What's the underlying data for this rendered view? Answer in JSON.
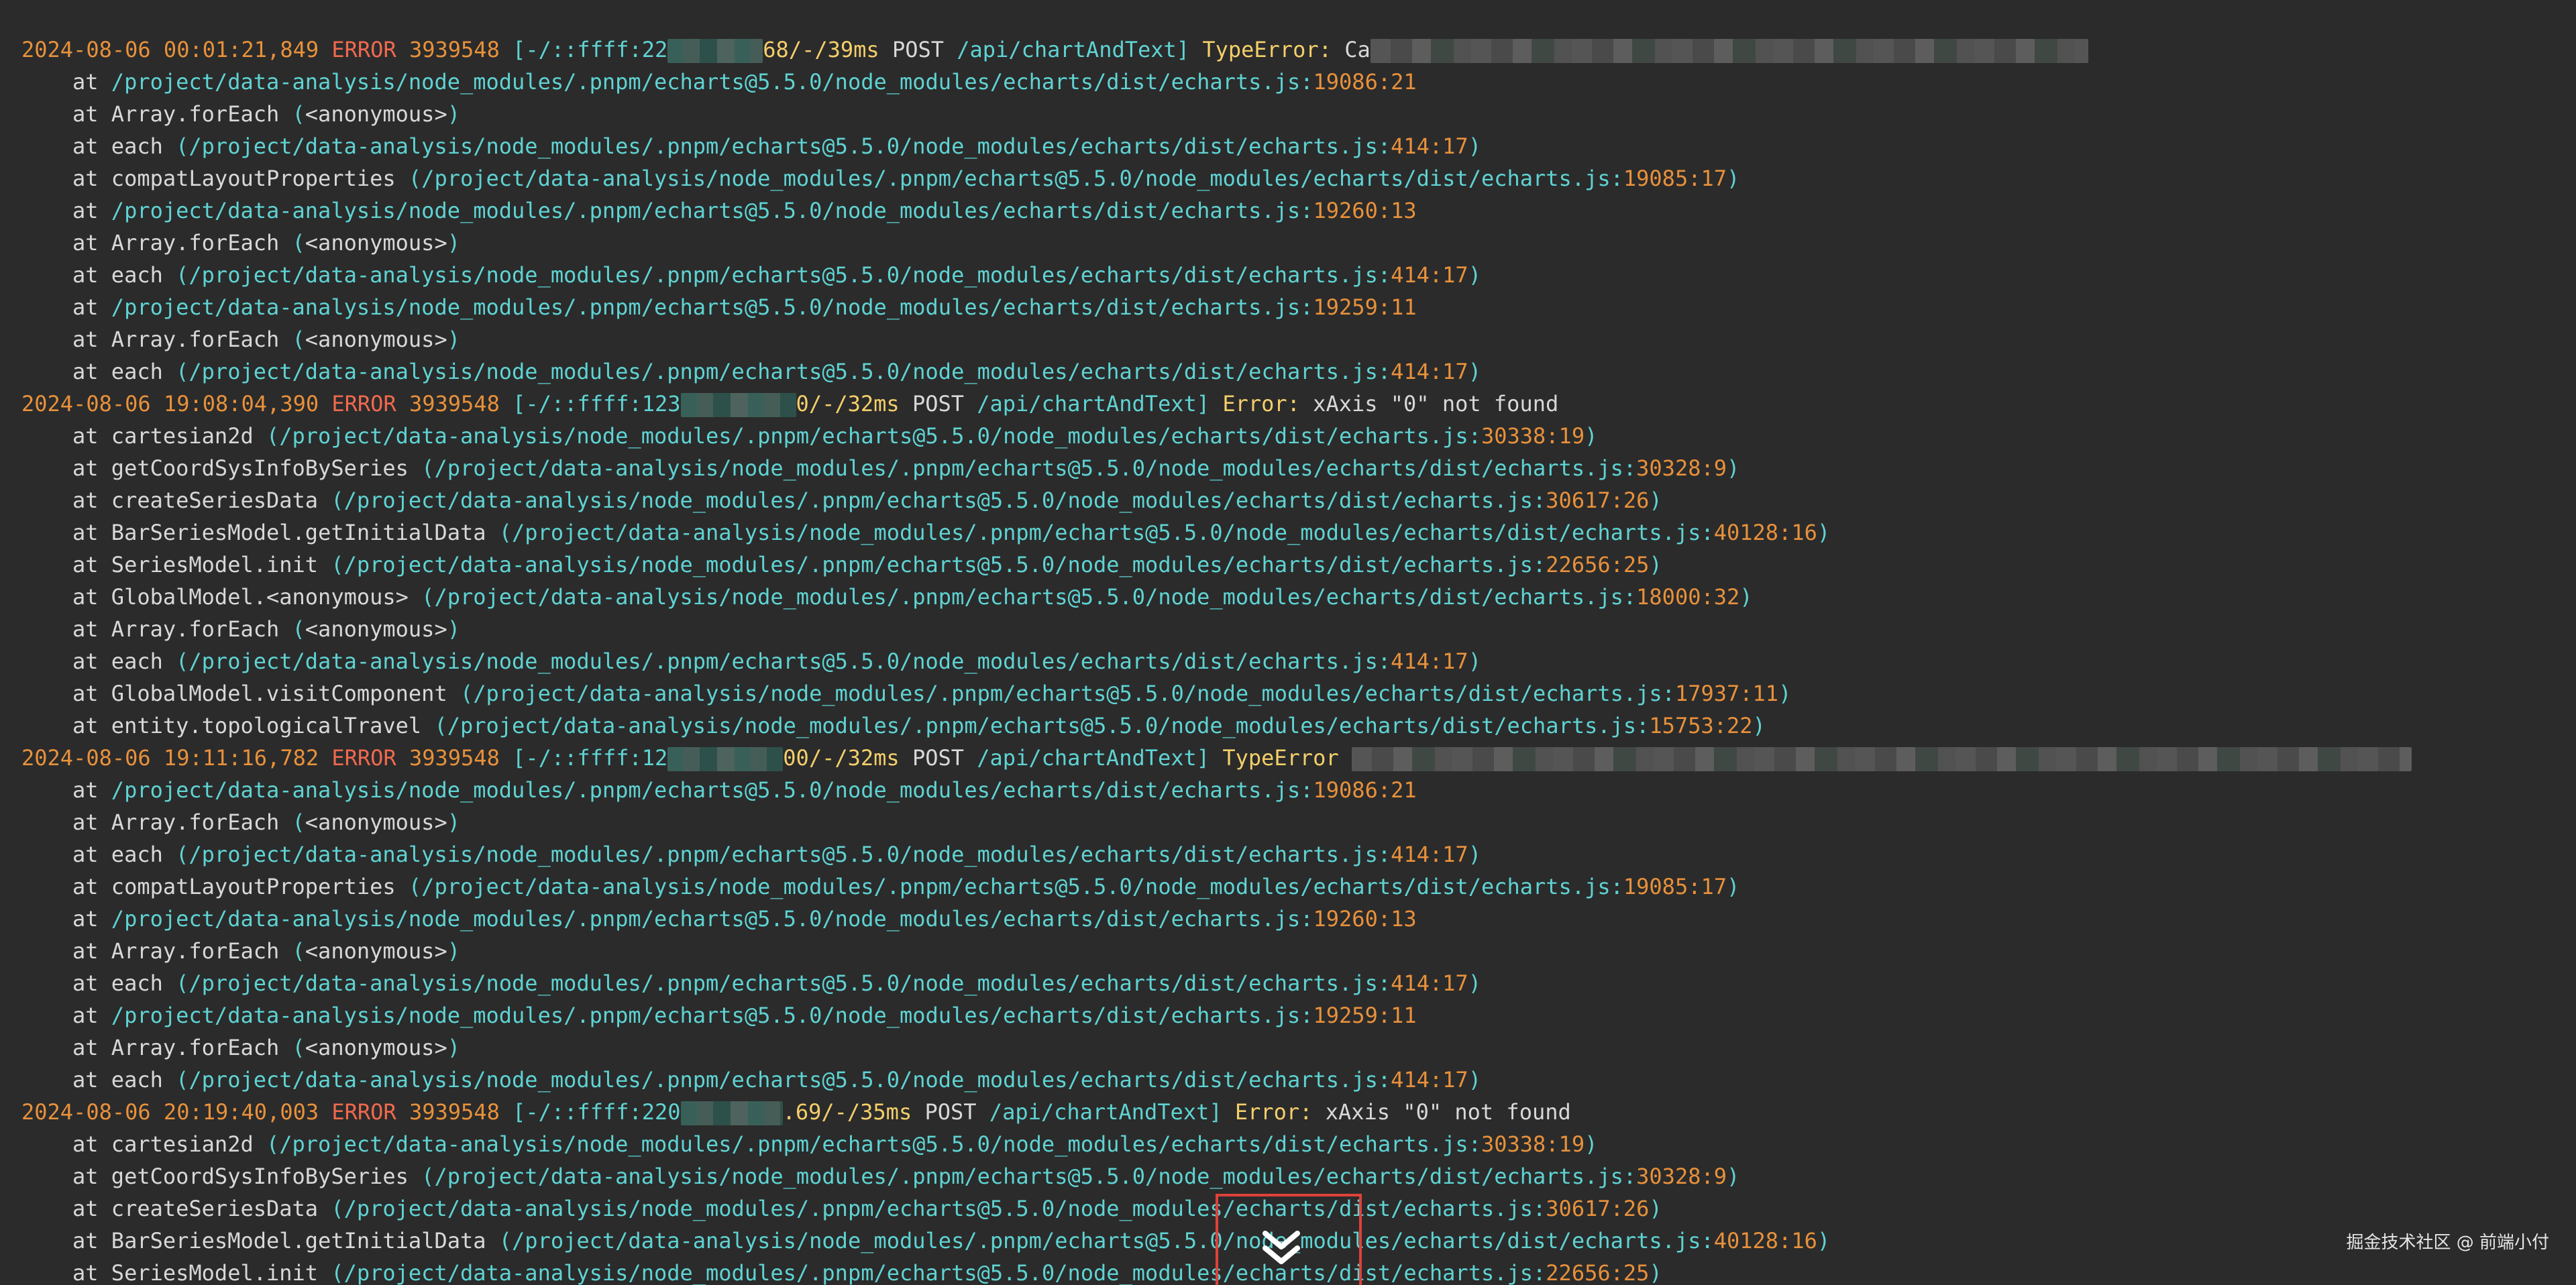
{
  "log": {
    "entries": [
      {
        "timestamp": "2024-08-06 00:01:21,849",
        "level": "ERROR",
        "pid": "3939548",
        "req_prefix": "[-/::ffff:22",
        "req_suffix": "68/-/39ms",
        "method": "POST",
        "path": "/api/chartAndText]",
        "error_type": "TypeError:",
        "error_msg": "Ca",
        "frames": [
          {
            "fn": "",
            "path": "/project/data-analysis/node_modules/.pnpm/echarts@5.5.0/node_modules/echarts/dist/echarts.js:",
            "pos": "19086:21"
          },
          {
            "fn": "Array.forEach",
            "path": "<anonymous>",
            "pos": ""
          },
          {
            "fn": "each",
            "path": "/project/data-analysis/node_modules/.pnpm/echarts@5.5.0/node_modules/echarts/dist/echarts.js:",
            "pos": "414:17"
          },
          {
            "fn": "compatLayoutProperties",
            "path": "/project/data-analysis/node_modules/.pnpm/echarts@5.5.0/node_modules/echarts/dist/echarts.js:",
            "pos": "19085:17"
          },
          {
            "fn": "",
            "path": "/project/data-analysis/node_modules/.pnpm/echarts@5.5.0/node_modules/echarts/dist/echarts.js:",
            "pos": "19260:13"
          },
          {
            "fn": "Array.forEach",
            "path": "<anonymous>",
            "pos": ""
          },
          {
            "fn": "each",
            "path": "/project/data-analysis/node_modules/.pnpm/echarts@5.5.0/node_modules/echarts/dist/echarts.js:",
            "pos": "414:17"
          },
          {
            "fn": "",
            "path": "/project/data-analysis/node_modules/.pnpm/echarts@5.5.0/node_modules/echarts/dist/echarts.js:",
            "pos": "19259:11"
          },
          {
            "fn": "Array.forEach",
            "path": "<anonymous>",
            "pos": ""
          },
          {
            "fn": "each",
            "path": "/project/data-analysis/node_modules/.pnpm/echarts@5.5.0/node_modules/echarts/dist/echarts.js:",
            "pos": "414:17"
          }
        ]
      },
      {
        "timestamp": "2024-08-06 19:08:04,390",
        "level": "ERROR",
        "pid": "3939548",
        "req_prefix": "[-/::ffff:123",
        "req_suffix": "0/-/32ms",
        "method": "POST",
        "path": "/api/chartAndText]",
        "error_type": "Error:",
        "error_msg": "xAxis \"0\" not found",
        "frames": [
          {
            "fn": "cartesian2d",
            "path": "/project/data-analysis/node_modules/.pnpm/echarts@5.5.0/node_modules/echarts/dist/echarts.js:",
            "pos": "30338:19"
          },
          {
            "fn": "getCoordSysInfoBySeries",
            "path": "/project/data-analysis/node_modules/.pnpm/echarts@5.5.0/node_modules/echarts/dist/echarts.js:",
            "pos": "30328:9"
          },
          {
            "fn": "createSeriesData",
            "path": "/project/data-analysis/node_modules/.pnpm/echarts@5.5.0/node_modules/echarts/dist/echarts.js:",
            "pos": "30617:26"
          },
          {
            "fn": "BarSeriesModel.getInitialData",
            "path": "/project/data-analysis/node_modules/.pnpm/echarts@5.5.0/node_modules/echarts/dist/echarts.js:",
            "pos": "40128:16"
          },
          {
            "fn": "SeriesModel.init",
            "path": "/project/data-analysis/node_modules/.pnpm/echarts@5.5.0/node_modules/echarts/dist/echarts.js:",
            "pos": "22656:25"
          },
          {
            "fn": "GlobalModel.<anonymous>",
            "path": "/project/data-analysis/node_modules/.pnpm/echarts@5.5.0/node_modules/echarts/dist/echarts.js:",
            "pos": "18000:32"
          },
          {
            "fn": "Array.forEach",
            "path": "<anonymous>",
            "pos": ""
          },
          {
            "fn": "each",
            "path": "/project/data-analysis/node_modules/.pnpm/echarts@5.5.0/node_modules/echarts/dist/echarts.js:",
            "pos": "414:17"
          },
          {
            "fn": "GlobalModel.visitComponent",
            "path": "/project/data-analysis/node_modules/.pnpm/echarts@5.5.0/node_modules/echarts/dist/echarts.js:",
            "pos": "17937:11"
          },
          {
            "fn": "entity.topologicalTravel",
            "path": "/project/data-analysis/node_modules/.pnpm/echarts@5.5.0/node_modules/echarts/dist/echarts.js:",
            "pos": "15753:22"
          }
        ]
      },
      {
        "timestamp": "2024-08-06 19:11:16,782",
        "level": "ERROR",
        "pid": "3939548",
        "req_prefix": "[-/::ffff:12",
        "req_suffix": "00/-/32ms",
        "method": "POST",
        "path": "/api/chartAndText]",
        "error_type": "TypeError",
        "error_msg": "",
        "frames": [
          {
            "fn": "",
            "path": "/project/data-analysis/node_modules/.pnpm/echarts@5.5.0/node_modules/echarts/dist/echarts.js:",
            "pos": "19086:21"
          },
          {
            "fn": "Array.forEach",
            "path": "<anonymous>",
            "pos": ""
          },
          {
            "fn": "each",
            "path": "/project/data-analysis/node_modules/.pnpm/echarts@5.5.0/node_modules/echarts/dist/echarts.js:",
            "pos": "414:17"
          },
          {
            "fn": "compatLayoutProperties",
            "path": "/project/data-analysis/node_modules/.pnpm/echarts@5.5.0/node_modules/echarts/dist/echarts.js:",
            "pos": "19085:17"
          },
          {
            "fn": "",
            "path": "/project/data-analysis/node_modules/.pnpm/echarts@5.5.0/node_modules/echarts/dist/echarts.js:",
            "pos": "19260:13"
          },
          {
            "fn": "Array.forEach",
            "path": "<anonymous>",
            "pos": ""
          },
          {
            "fn": "each",
            "path": "/project/data-analysis/node_modules/.pnpm/echarts@5.5.0/node_modules/echarts/dist/echarts.js:",
            "pos": "414:17"
          },
          {
            "fn": "",
            "path": "/project/data-analysis/node_modules/.pnpm/echarts@5.5.0/node_modules/echarts/dist/echarts.js:",
            "pos": "19259:11"
          },
          {
            "fn": "Array.forEach",
            "path": "<anonymous>",
            "pos": ""
          },
          {
            "fn": "each",
            "path": "/project/data-analysis/node_modules/.pnpm/echarts@5.5.0/node_modules/echarts/dist/echarts.js:",
            "pos": "414:17"
          }
        ]
      },
      {
        "timestamp": "2024-08-06 20:19:40,003",
        "level": "ERROR",
        "pid": "3939548",
        "req_prefix": "[-/::ffff:220",
        "req_suffix": ".69/-/35ms",
        "method": "POST",
        "path": "/api/chartAndText]",
        "error_type": "Error:",
        "error_msg": "xAxis \"0\" not found",
        "frames": [
          {
            "fn": "cartesian2d",
            "path": "/project/data-analysis/node_modules/.pnpm/echarts@5.5.0/node_modules/echarts/dist/echarts.js:",
            "pos": "30338:19"
          },
          {
            "fn": "getCoordSysInfoBySeries",
            "path": "/project/data-analysis/node_modules/.pnpm/echarts@5.5.0/node_modules/echarts/dist/echarts.js:",
            "pos": "30328:9"
          },
          {
            "fn": "createSeriesData",
            "path": "/project/data-analysis/node_modules/.pnpm/echarts@5.5.0/node_modules/echarts/dist/echarts.js:",
            "pos": "30617:26"
          },
          {
            "fn": "BarSeriesModel.getInitialData",
            "path": "/project/data-analysis/node_modules/.pnpm/echarts@5.5.0/node_modules/echarts/dist/echarts.js:",
            "pos": "40128:16"
          },
          {
            "fn": "SeriesModel.init",
            "path": "/project/data-analysis/node_modules/.pnpm/echarts@5.5.0/node_modules/echarts/dist/echarts.js:",
            "pos": "22656:25"
          }
        ]
      }
    ]
  },
  "watermark": {
    "text": "掘金技术社区 @ 前端小付"
  },
  "icons": {
    "scroll_down": "double-chevron-down-icon"
  },
  "colors": {
    "background": "#2b2b2b",
    "timestamp": "#e8913b",
    "error": "#f0694e",
    "path": "#5fd3d3",
    "highlight": "#e0413a"
  }
}
